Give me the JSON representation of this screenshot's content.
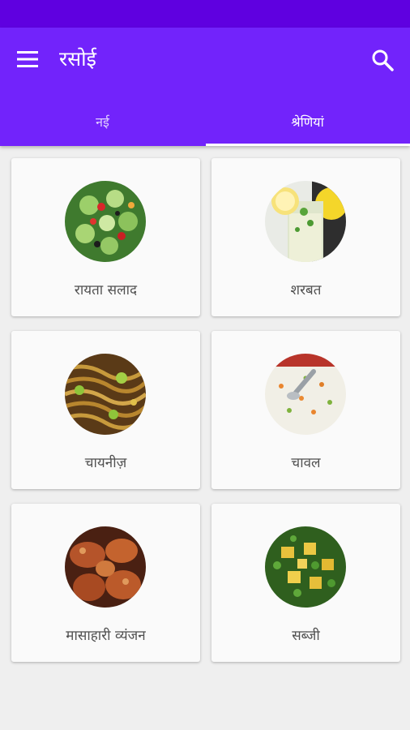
{
  "app": {
    "title": "रसोई",
    "colors": {
      "status_bar": "#5f00e0",
      "app_bar": "#7223fb",
      "background": "#efefef",
      "card": "#fafafa"
    }
  },
  "toolbar": {
    "menu_icon": "hamburger-menu-icon",
    "search_icon": "search-icon"
  },
  "tabs": [
    {
      "label": "नई",
      "selected": false
    },
    {
      "label": "श्रेणियां",
      "selected": true
    }
  ],
  "categories": [
    {
      "label": "रायता सलाद",
      "image": "salad-photo"
    },
    {
      "label": "शरबत",
      "image": "lemonade-photo"
    },
    {
      "label": "चायनीज़",
      "image": "noodles-photo"
    },
    {
      "label": "चावल",
      "image": "rice-photo"
    },
    {
      "label": "मासाहारी  व्यंजन",
      "image": "chicken-photo"
    },
    {
      "label": "सब्जी",
      "image": "vegetable-curry-photo"
    }
  ]
}
